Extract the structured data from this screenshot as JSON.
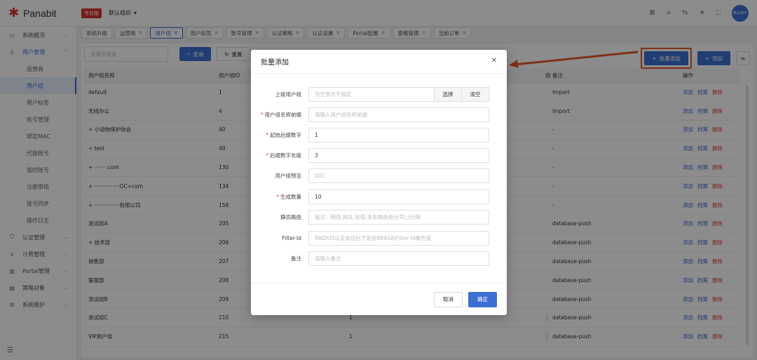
{
  "header": {
    "logo_text": "Panabit",
    "edition_badge": "专业版",
    "org_select": "默认组织",
    "avatar_text": "默认用户"
  },
  "sidebar": {
    "items": [
      {
        "label": "系统概况",
        "icon": "monitor-icon"
      },
      {
        "label": "用户管理",
        "icon": "user-icon"
      },
      {
        "label": "认证管理",
        "icon": "shield-icon"
      },
      {
        "label": "计费管理",
        "icon": "trophy-icon"
      },
      {
        "label": "Portal管理",
        "icon": "portal-icon"
      },
      {
        "label": "策略对象",
        "icon": "list-icon"
      },
      {
        "label": "系统维护",
        "icon": "gear-icon"
      }
    ],
    "sub_items": [
      "运营商",
      "用户组",
      "用户标签",
      "账号管理",
      "绑定MAC",
      "代拨账号",
      "临时账号",
      "注册审核",
      "账号同步",
      "操作日志"
    ]
  },
  "tabs": [
    "系统升级",
    "运营商",
    "用户组",
    "用户标签",
    "账号管理",
    "认证策略",
    "认证设置",
    "Portal配置",
    "套餐管理",
    "当前订单"
  ],
  "filter": {
    "keyword_placeholder": "关键字搜索",
    "search_label": "查询",
    "reset_label": "重置"
  },
  "actions": {
    "batch_add_label": "批量添加",
    "add_label": "添加"
  },
  "table": {
    "headers": [
      "用户组名称",
      "用户组ID",
      "",
      "",
      "组",
      "备注",
      "操作"
    ],
    "rows": [
      {
        "name": "default",
        "id": "1",
        "mid": "",
        "remark": "Import"
      },
      {
        "name": "无线办公",
        "id": "4",
        "mid": "",
        "remark": "Import"
      },
      {
        "name": "+ 小动物保护协会",
        "id": "40",
        "mid": "",
        "remark": "-"
      },
      {
        "name": "+ test",
        "id": "49",
        "mid": "",
        "remark": "-"
      },
      {
        "name": "+ ·······.com",
        "id": "130",
        "mid": "",
        "remark": "-"
      },
      {
        "name": "+ ···············OC=com",
        "id": "134",
        "mid": "",
        "remark": "-"
      },
      {
        "name": "+ ···············有限公司",
        "id": "158",
        "mid": "",
        "remark": "-"
      },
      {
        "name": "测试组A",
        "id": "205",
        "mid": "",
        "remark": "database-push"
      },
      {
        "name": "+ 技术部",
        "id": "206",
        "mid": "",
        "remark": "database-push"
      },
      {
        "name": "销售部",
        "id": "207",
        "mid": "",
        "remark": "database-push"
      },
      {
        "name": "客服部",
        "id": "208",
        "mid": "",
        "remark": "database-push"
      },
      {
        "name": "测试组B",
        "id": "209",
        "mid": "",
        "remark": "database-push"
      },
      {
        "name": "测试组C",
        "id": "210",
        "mid": "1",
        "remark": "database-push"
      },
      {
        "name": "VIP用户组",
        "id": "215",
        "mid": "1",
        "remark": "database-push"
      }
    ],
    "op_add": "添加",
    "op_file": "档案",
    "op_delete": "删除"
  },
  "modal": {
    "title": "批量添加",
    "fields": [
      {
        "label": "上级用户组",
        "required": false,
        "value": "",
        "placeholder": "为空表示不指定"
      },
      {
        "label": "用户组名称前缀",
        "required": true,
        "value": "",
        "placeholder": "请输入用户组名称前缀"
      },
      {
        "label": "起始后缀数字",
        "required": true,
        "value": "1",
        "placeholder": ""
      },
      {
        "label": "后缀数字长度",
        "required": true,
        "value": "3",
        "placeholder": ""
      },
      {
        "label": "用户组预览",
        "required": false,
        "value": "",
        "placeholder": "001"
      },
      {
        "label": "生成数量",
        "required": true,
        "value": "10",
        "placeholder": ""
      },
      {
        "label": "静态路由",
        "required": false,
        "value": "",
        "placeholder": "格式：网段,网关,权值;多条路由用分号(;)分隔"
      },
      {
        "label": "Filter-Id",
        "required": false,
        "value": "",
        "placeholder": "RADIUS认证成功后下发给BRAS的Filter-Id属性值"
      },
      {
        "label": "备注",
        "required": false,
        "value": "",
        "placeholder": "请输入备注"
      }
    ],
    "select_label": "选择",
    "clear_label": "清空",
    "cancel_label": "取消",
    "confirm_label": "确定"
  },
  "colors": {
    "brand_red": "#d9332c",
    "primary_blue": "#3b6fd4",
    "annotation_orange": "#e8582a"
  }
}
